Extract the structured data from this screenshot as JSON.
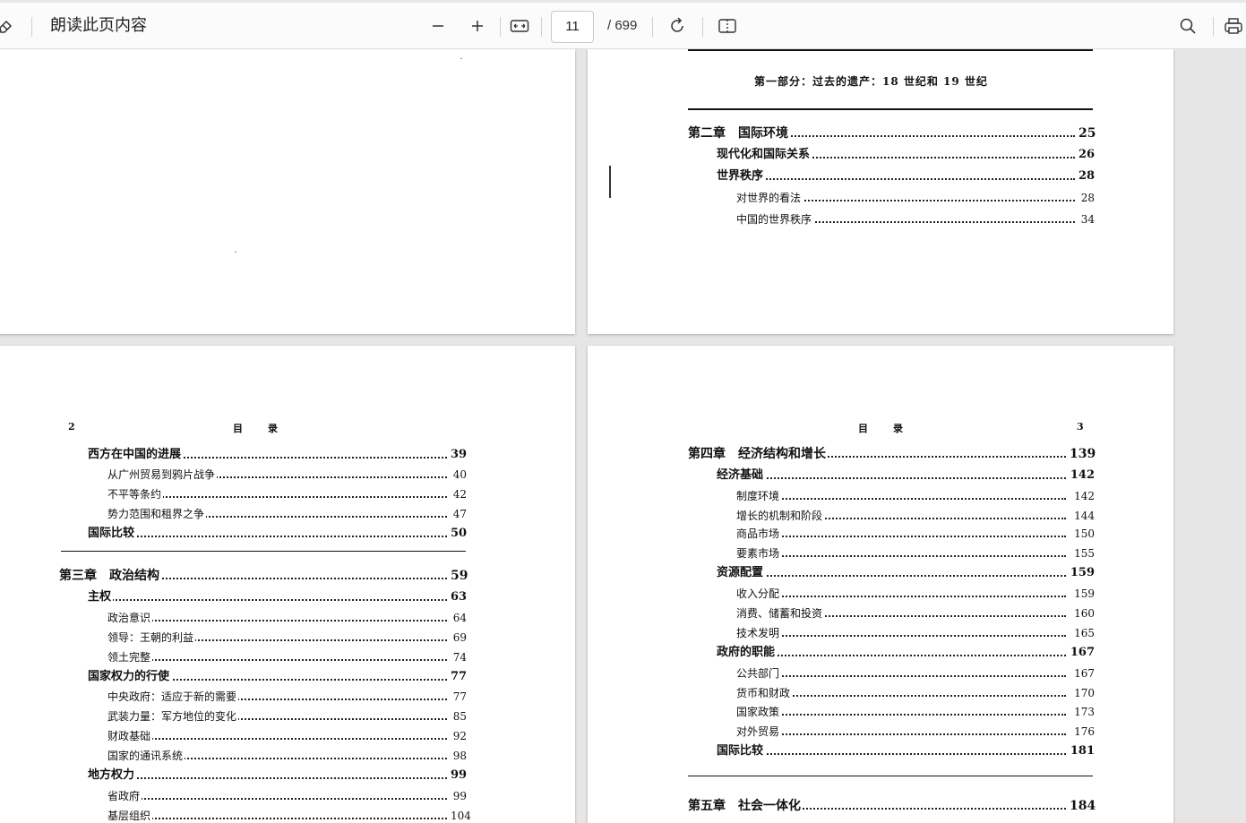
{
  "toolbar": {
    "read_aloud_label": "朗读此页内容",
    "current_page": "11",
    "total_pages": "/ 699",
    "icons": [
      "eraser-icon",
      "zoom-out-icon",
      "zoom-in-icon",
      "fit-width-icon",
      "rotate-icon",
      "two-page-view-icon",
      "search-icon",
      "print-icon"
    ]
  },
  "page_top_right": {
    "part_title": "第一部分：过去的遗产：18 世纪和 19 世纪",
    "entries": [
      {
        "text": "第二章　国际环境",
        "page": "25",
        "level": 1
      },
      {
        "text": "现代化和国际关系",
        "page": "26",
        "level": 2
      },
      {
        "text": "世界秩序",
        "page": "28",
        "level": 2
      },
      {
        "text": "对世界的看法",
        "page": "28",
        "level": 3
      },
      {
        "text": "中国的世界秩序",
        "page": "34",
        "level": 3
      }
    ]
  },
  "page_bottom_left": {
    "page_no": "2",
    "header": "目　　录",
    "entries": [
      {
        "text": "西方在中国的进展",
        "page": "39",
        "level": 2
      },
      {
        "text": "从广州贸易到鸦片战争",
        "page": "40",
        "level": 3
      },
      {
        "text": "不平等条约",
        "page": "42",
        "level": 3
      },
      {
        "text": "势力范围和租界之争",
        "page": "47",
        "level": 3
      },
      {
        "text": "国际比较",
        "page": "50",
        "level": 2
      },
      {
        "text": "第三章　政治结构",
        "page": "59",
        "level": 1
      },
      {
        "text": "主权",
        "page": "63",
        "level": 2
      },
      {
        "text": "政治意识",
        "page": "64",
        "level": 3
      },
      {
        "text": "领导：王朝的利益",
        "page": "69",
        "level": 3
      },
      {
        "text": "领土完整",
        "page": "74",
        "level": 3
      },
      {
        "text": "国家权力的行使",
        "page": "77",
        "level": 2
      },
      {
        "text": "中央政府：适应于新的需要",
        "page": "77",
        "level": 3
      },
      {
        "text": "武装力量：军方地位的变化",
        "page": "85",
        "level": 3
      },
      {
        "text": "财政基础",
        "page": "92",
        "level": 3
      },
      {
        "text": "国家的通讯系统",
        "page": "98",
        "level": 3
      },
      {
        "text": "地方权力",
        "page": "99",
        "level": 2
      },
      {
        "text": "省政府",
        "page": "99",
        "level": 3
      },
      {
        "text": "基层组织",
        "page": "104",
        "level": 3
      }
    ]
  },
  "page_bottom_right": {
    "page_no": "3",
    "header": "目　　录",
    "entries": [
      {
        "text": "第四章　经济结构和增长",
        "page": "139",
        "level": 1
      },
      {
        "text": "经济基础",
        "page": "142",
        "level": 2
      },
      {
        "text": "制度环境",
        "page": "142",
        "level": 3
      },
      {
        "text": "增长的机制和阶段",
        "page": "144",
        "level": 3
      },
      {
        "text": "商品市场",
        "page": "150",
        "level": 3
      },
      {
        "text": "要素市场",
        "page": "155",
        "level": 3
      },
      {
        "text": "资源配置",
        "page": "159",
        "level": 2
      },
      {
        "text": "收入分配",
        "page": "159",
        "level": 3
      },
      {
        "text": "消费、储蓄和投资",
        "page": "160",
        "level": 3
      },
      {
        "text": "技术发明",
        "page": "165",
        "level": 3
      },
      {
        "text": "政府的职能",
        "page": "167",
        "level": 2
      },
      {
        "text": "公共部门",
        "page": "167",
        "level": 3
      },
      {
        "text": "货币和财政",
        "page": "170",
        "level": 3
      },
      {
        "text": "国家政策",
        "page": "173",
        "level": 3
      },
      {
        "text": "对外贸易",
        "page": "176",
        "level": 3
      },
      {
        "text": "国际比较",
        "page": "181",
        "level": 2
      },
      {
        "text": "第五章　社会一体化",
        "page": "184",
        "level": 1
      }
    ]
  }
}
